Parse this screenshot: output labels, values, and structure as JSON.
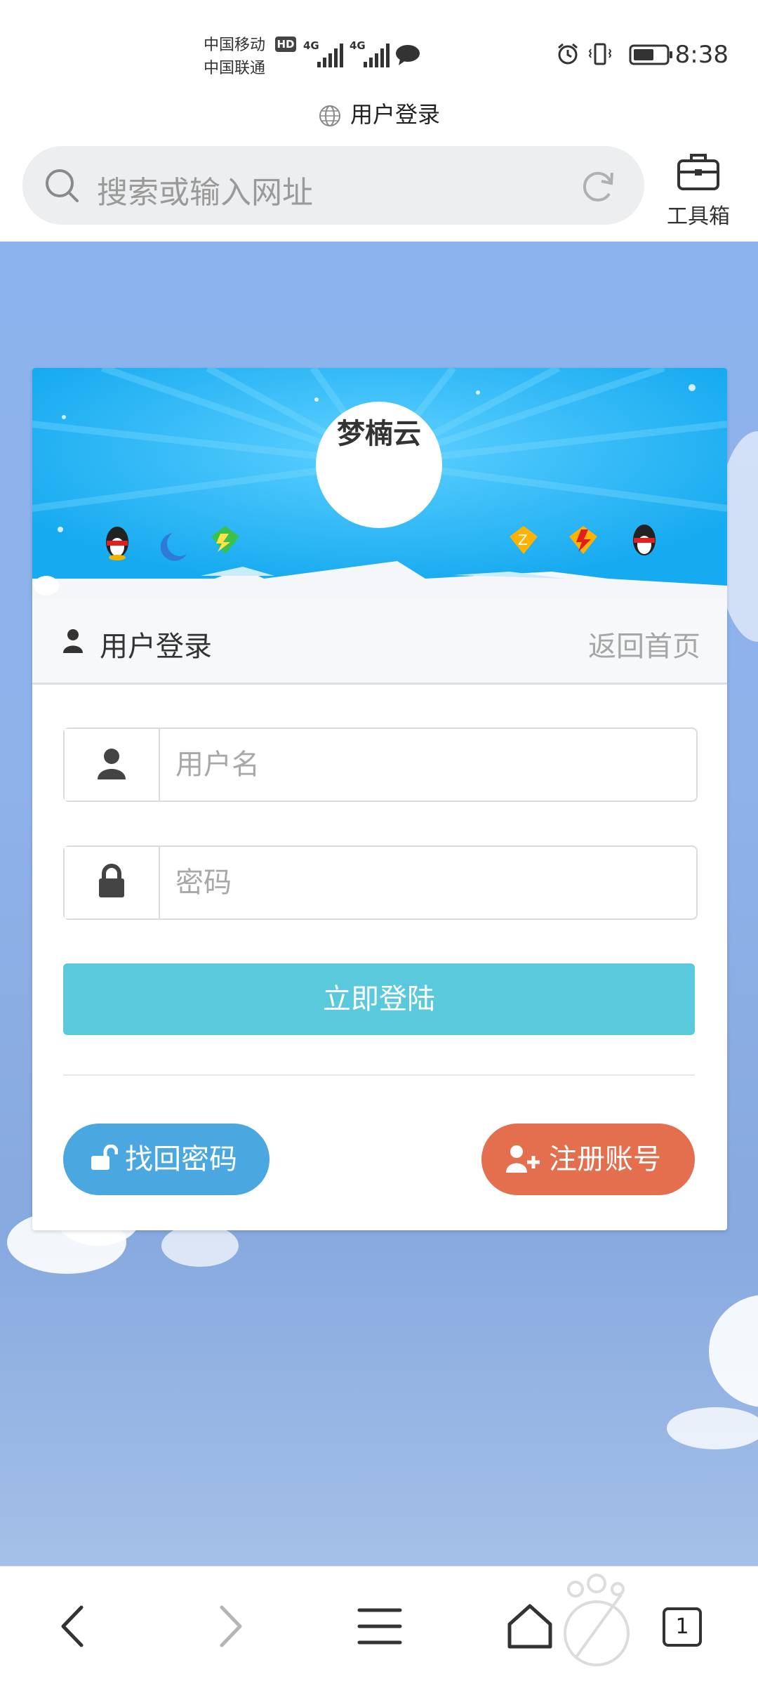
{
  "status_bar": {
    "carrier1": "中国移动",
    "carrier2": "中国联通",
    "hd": "HD",
    "net1": "4G",
    "net2": "4G",
    "time": "8:38"
  },
  "page": {
    "title": "用户登录"
  },
  "search": {
    "placeholder": "搜索或输入网址"
  },
  "toolbox": {
    "label": "工具箱"
  },
  "card": {
    "logo_text": "梦楠云",
    "header_title": "用户登录",
    "back_home": "返回首页",
    "username_placeholder": "用户名",
    "password_placeholder": "密码",
    "login_button": "立即登陆",
    "forgot_button": "找回密码",
    "register_button": "注册账号"
  },
  "bottom_nav": {
    "tab_count": "1"
  },
  "colors": {
    "login_button": "#5bc9dc",
    "forgot_button": "#4aa7e0",
    "register_button": "#e36f4e",
    "banner": "#16aaf0"
  },
  "icons": [
    "search-icon",
    "refresh-icon",
    "toolbox-icon",
    "user-icon",
    "lock-icon",
    "unlock-icon",
    "add-user-icon",
    "back-icon",
    "forward-icon",
    "menu-icon",
    "home-icon"
  ]
}
